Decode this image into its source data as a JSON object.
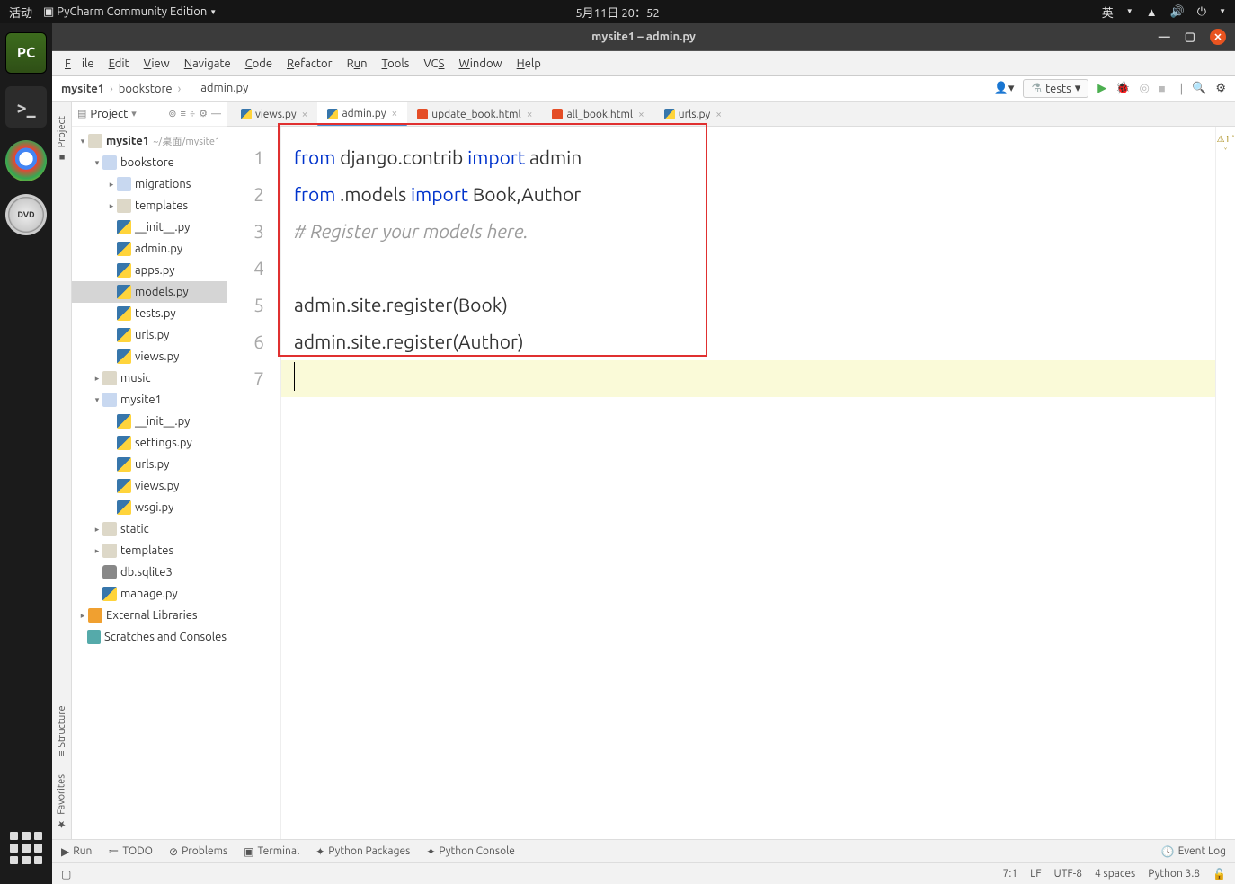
{
  "os": {
    "activities": "活动",
    "app": "PyCharm Community Edition",
    "datetime": "5月11日  20：52",
    "lang": "英"
  },
  "window": {
    "title": "mysite1 – admin.py"
  },
  "menu": {
    "file": "File",
    "edit": "Edit",
    "view": "View",
    "navigate": "Navigate",
    "code": "Code",
    "refactor": "Refactor",
    "run": "Run",
    "tools": "Tools",
    "vcs": "VCS",
    "window": "Window",
    "help": "Help"
  },
  "breadcrumb": {
    "root": "mysite1",
    "mid": "bookstore",
    "file": "admin.py",
    "config": "tests"
  },
  "project": {
    "title": "Project",
    "root": {
      "name": "mysite1",
      "loc": "~/桌面/mysite1"
    },
    "items": [
      {
        "d": 1,
        "ar": "o",
        "ic": "pydir",
        "name": "bookstore"
      },
      {
        "d": 2,
        "ar": "c",
        "ic": "pydir",
        "name": "migrations"
      },
      {
        "d": 2,
        "ar": "c",
        "ic": "dir",
        "name": "templates"
      },
      {
        "d": 2,
        "ar": "n",
        "ic": "py",
        "name": "__init__.py"
      },
      {
        "d": 2,
        "ar": "n",
        "ic": "py",
        "name": "admin.py"
      },
      {
        "d": 2,
        "ar": "n",
        "ic": "py",
        "name": "apps.py"
      },
      {
        "d": 2,
        "ar": "n",
        "ic": "py",
        "name": "models.py",
        "sel": true
      },
      {
        "d": 2,
        "ar": "n",
        "ic": "py",
        "name": "tests.py"
      },
      {
        "d": 2,
        "ar": "n",
        "ic": "py",
        "name": "urls.py"
      },
      {
        "d": 2,
        "ar": "n",
        "ic": "py",
        "name": "views.py"
      },
      {
        "d": 1,
        "ar": "c",
        "ic": "dir",
        "name": "music"
      },
      {
        "d": 1,
        "ar": "o",
        "ic": "pydir",
        "name": "mysite1"
      },
      {
        "d": 2,
        "ar": "n",
        "ic": "py",
        "name": "__init__.py"
      },
      {
        "d": 2,
        "ar": "n",
        "ic": "py",
        "name": "settings.py"
      },
      {
        "d": 2,
        "ar": "n",
        "ic": "py",
        "name": "urls.py"
      },
      {
        "d": 2,
        "ar": "n",
        "ic": "py",
        "name": "views.py"
      },
      {
        "d": 2,
        "ar": "n",
        "ic": "py",
        "name": "wsgi.py"
      },
      {
        "d": 1,
        "ar": "c",
        "ic": "dir",
        "name": "static"
      },
      {
        "d": 1,
        "ar": "c",
        "ic": "dir",
        "name": "templates"
      },
      {
        "d": 1,
        "ar": "n",
        "ic": "db",
        "name": "db.sqlite3"
      },
      {
        "d": 1,
        "ar": "n",
        "ic": "py",
        "name": "manage.py"
      }
    ],
    "extlib": "External Libraries",
    "scratch": "Scratches and Consoles"
  },
  "tabs": [
    {
      "name": "views.py",
      "ic": "py"
    },
    {
      "name": "admin.py",
      "ic": "py",
      "active": true
    },
    {
      "name": "update_book.html",
      "ic": "html"
    },
    {
      "name": "all_book.html",
      "ic": "html"
    },
    {
      "name": "urls.py",
      "ic": "py"
    }
  ],
  "code": {
    "lines": [
      "1",
      "2",
      "3",
      "4",
      "5",
      "6",
      "7"
    ],
    "l1a": "from",
    "l1b": " django.contrib ",
    "l1c": "import",
    "l1d": " admin",
    "l2a": "from",
    "l2b": " .models ",
    "l2c": "import",
    "l2d": " Book,Author",
    "l3": "# Register your models here.",
    "l5": "admin.site.register(Book)",
    "l6": "admin.site.register(Author)"
  },
  "editor_hint": "1",
  "toolwin": {
    "run": "Run",
    "todo": "TODO",
    "problems": "Problems",
    "terminal": "Terminal",
    "pypkg": "Python Packages",
    "pyconsole": "Python Console",
    "eventlog": "Event Log"
  },
  "status": {
    "pos": "7:1",
    "lf": "LF",
    "enc": "UTF-8",
    "indent": "4 spaces",
    "py": "Python 3.8"
  },
  "sidetabs": {
    "project": "Project",
    "structure": "Structure",
    "favorites": "Favorites"
  }
}
